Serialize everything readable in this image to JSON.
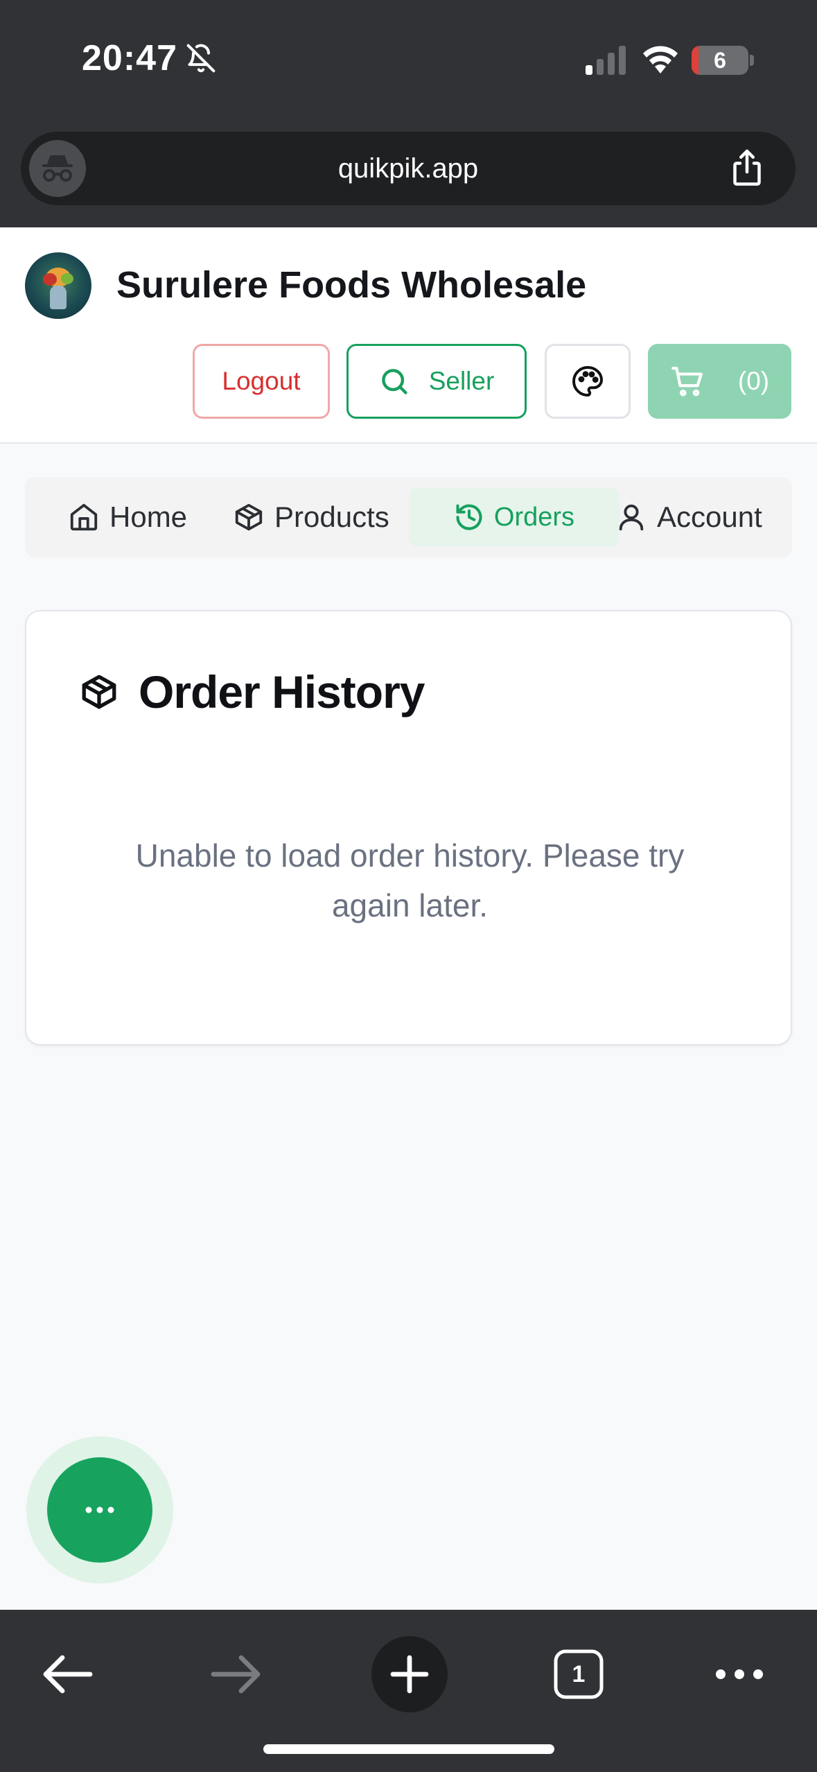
{
  "status_bar": {
    "time": "20:47",
    "battery_level": "6",
    "battery_fraction": 0.06
  },
  "browser": {
    "url": "quikpik.app",
    "tab_count": "1"
  },
  "header": {
    "brand": "Surulere Foods Wholesale",
    "logout_label": "Logout",
    "seller_label": "Seller",
    "cart_label": "(0)"
  },
  "nav": {
    "home": "Home",
    "products": "Products",
    "orders": "Orders",
    "account": "Account"
  },
  "orders": {
    "title": "Order History",
    "message": "Unable to load order history. Please try again later."
  },
  "colors": {
    "accent": "#16a05d",
    "logout": "#d72f2f",
    "cart_bg": "#8fd4b2",
    "chrome_bg": "#303235"
  },
  "icons": {
    "incognito": "incognito-icon",
    "share": "share-icon",
    "search": "search-icon",
    "palette": "palette-icon",
    "cart": "cart-icon",
    "home": "home-icon",
    "package": "package-icon",
    "history": "history-icon",
    "user": "user-icon",
    "more": "more-horizontal-icon"
  }
}
